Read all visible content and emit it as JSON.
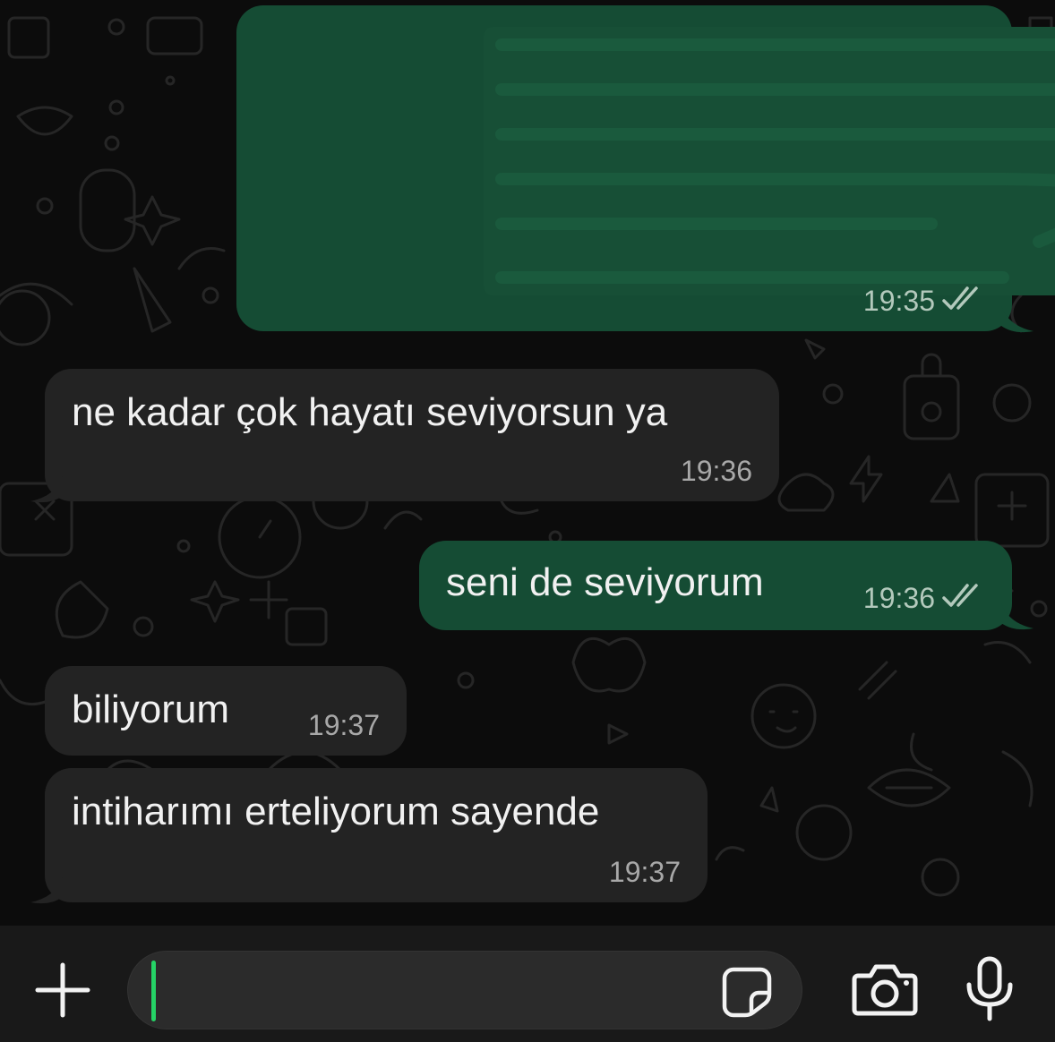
{
  "colors": {
    "outgoing_bubble": "#154c34",
    "incoming_bubble": "#232323",
    "cursor_accent": "#25d366",
    "read_ticks": "#b3c9bc"
  },
  "messages": [
    {
      "direction": "outgoing",
      "content": "redacted-media",
      "time": "19:35",
      "status": "read"
    },
    {
      "direction": "incoming",
      "text": "ne kadar çok hayatı seviyorsun ya",
      "time": "19:36"
    },
    {
      "direction": "outgoing",
      "text": "seni de seviyorum",
      "time": "19:36",
      "status": "read"
    },
    {
      "direction": "incoming",
      "text": "biliyorum",
      "time": "19:37"
    },
    {
      "direction": "incoming",
      "text": "intiharımı erteliyorum sayende",
      "time": "19:37"
    }
  ],
  "composer": {
    "value": "",
    "icons": {
      "attach": "plus-icon",
      "sticker": "sticker-icon",
      "camera": "camera-icon",
      "mic": "microphone-icon"
    }
  }
}
